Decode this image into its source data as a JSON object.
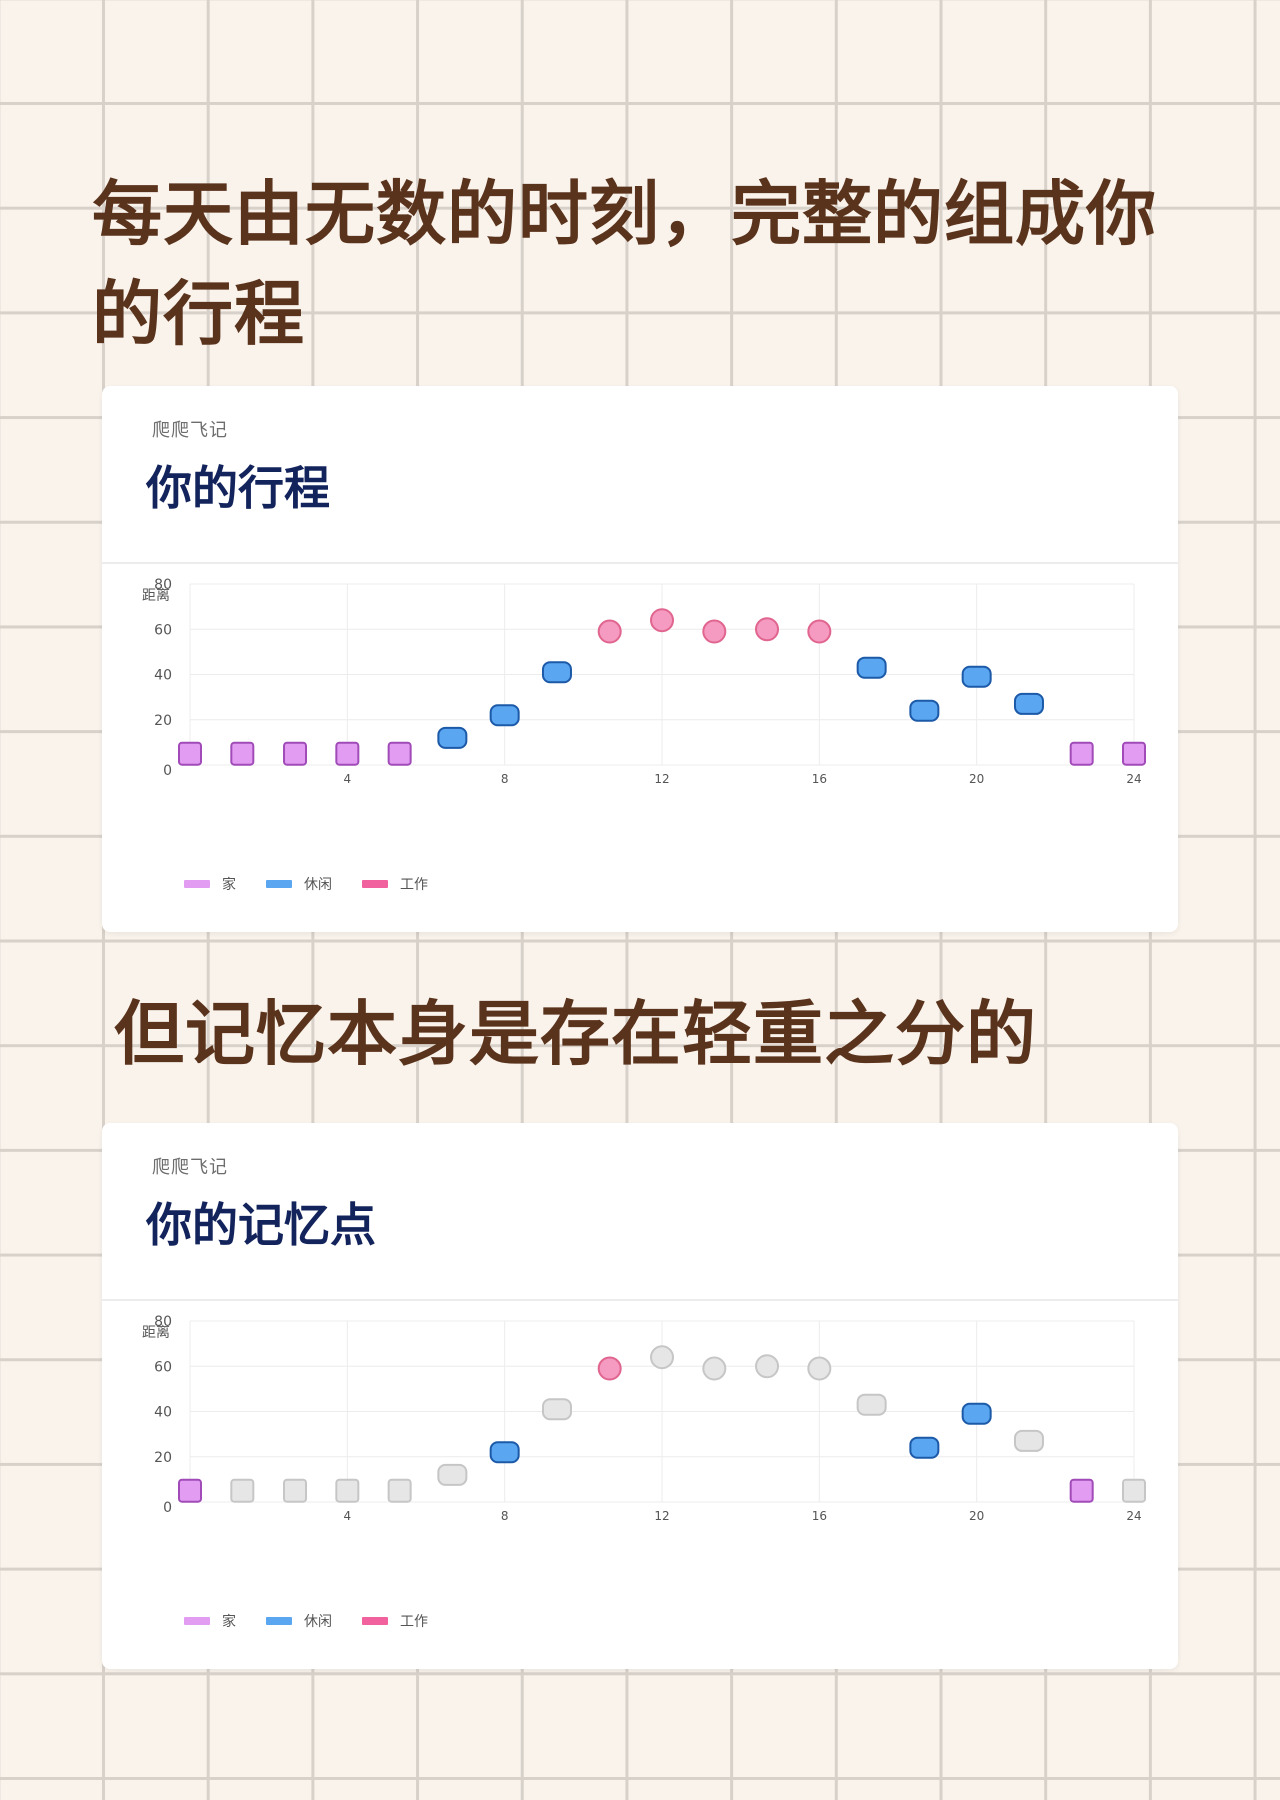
{
  "headline_top": "每天由无数的时刻，完整的组成你的行程",
  "headline_bottom": "但记忆本身是存在轻重之分的",
  "brand": "爬爬飞记",
  "colors": {
    "home": "#e29cf2",
    "home_border": "#a04bb8",
    "leisure": "#5aa6f0",
    "leisure_border": "#1c5aa8",
    "work": "#f59ac0",
    "work_border": "#e0658f",
    "muted": "#e6e6e6",
    "muted_border": "#c6c6c6",
    "legend_home": "#e29cf2",
    "legend_leisure": "#5aa6f0",
    "legend_work": "#f0619e"
  },
  "legend": [
    {
      "key": "home",
      "label": "家"
    },
    {
      "key": "leisure",
      "label": "休闲"
    },
    {
      "key": "work",
      "label": "工作"
    }
  ],
  "chart_data": [
    {
      "type": "scatter",
      "title": "你的行程",
      "ylabel": "距离",
      "xlim": [
        0,
        24
      ],
      "ylim": [
        0,
        80
      ],
      "x_ticks": [
        4,
        8,
        12,
        16,
        20,
        24
      ],
      "y_ticks": [
        0,
        20,
        40,
        60,
        80
      ],
      "grid": true,
      "legend_position": "bottom-left",
      "series": [
        {
          "name": "家",
          "key": "home",
          "marker": "square",
          "points": [
            {
              "x": 0,
              "y": 5
            },
            {
              "x": 1.33,
              "y": 5
            },
            {
              "x": 2.67,
              "y": 5
            },
            {
              "x": 4,
              "y": 5
            },
            {
              "x": 5.33,
              "y": 5
            },
            {
              "x": 22.67,
              "y": 5
            },
            {
              "x": 24,
              "y": 5
            }
          ]
        },
        {
          "name": "休闲",
          "key": "leisure",
          "marker": "rounded",
          "points": [
            {
              "x": 6.67,
              "y": 12
            },
            {
              "x": 8,
              "y": 22
            },
            {
              "x": 9.33,
              "y": 41
            },
            {
              "x": 17.33,
              "y": 43
            },
            {
              "x": 18.67,
              "y": 24
            },
            {
              "x": 20,
              "y": 39
            },
            {
              "x": 21.33,
              "y": 27
            }
          ]
        },
        {
          "name": "工作",
          "key": "work",
          "marker": "circle",
          "points": [
            {
              "x": 10.67,
              "y": 59
            },
            {
              "x": 12,
              "y": 64
            },
            {
              "x": 13.33,
              "y": 59
            },
            {
              "x": 14.67,
              "y": 60
            },
            {
              "x": 16,
              "y": 59
            }
          ]
        }
      ]
    },
    {
      "type": "scatter",
      "title": "你的记忆点",
      "ylabel": "距离",
      "xlim": [
        0,
        24
      ],
      "ylim": [
        0,
        80
      ],
      "x_ticks": [
        4,
        8,
        12,
        16,
        20,
        24
      ],
      "y_ticks": [
        0,
        20,
        40,
        60,
        80
      ],
      "grid": true,
      "legend_position": "bottom-left",
      "series": [
        {
          "name": "家",
          "key": "home",
          "marker": "square",
          "points": [
            {
              "x": 0,
              "y": 5
            },
            {
              "x": 22.67,
              "y": 5
            }
          ]
        },
        {
          "name": "休闲",
          "key": "leisure",
          "marker": "rounded",
          "points": [
            {
              "x": 8,
              "y": 22
            },
            {
              "x": 18.67,
              "y": 24
            },
            {
              "x": 20,
              "y": 39
            }
          ]
        },
        {
          "name": "工作",
          "key": "work",
          "marker": "circle",
          "points": [
            {
              "x": 10.67,
              "y": 59
            }
          ]
        },
        {
          "key": "muted",
          "marker": "muted-square",
          "points": [
            {
              "x": 1.33,
              "y": 5
            },
            {
              "x": 2.67,
              "y": 5
            },
            {
              "x": 4,
              "y": 5
            },
            {
              "x": 5.33,
              "y": 5
            },
            {
              "x": 24,
              "y": 5
            }
          ]
        },
        {
          "key": "muted",
          "marker": "muted-rounded",
          "points": [
            {
              "x": 6.67,
              "y": 12
            },
            {
              "x": 9.33,
              "y": 41
            },
            {
              "x": 17.33,
              "y": 43
            },
            {
              "x": 21.33,
              "y": 27
            }
          ]
        },
        {
          "key": "muted",
          "marker": "muted-circle",
          "points": [
            {
              "x": 12,
              "y": 64
            },
            {
              "x": 13.33,
              "y": 59
            },
            {
              "x": 14.67,
              "y": 60
            },
            {
              "x": 16,
              "y": 59
            }
          ]
        }
      ]
    }
  ]
}
